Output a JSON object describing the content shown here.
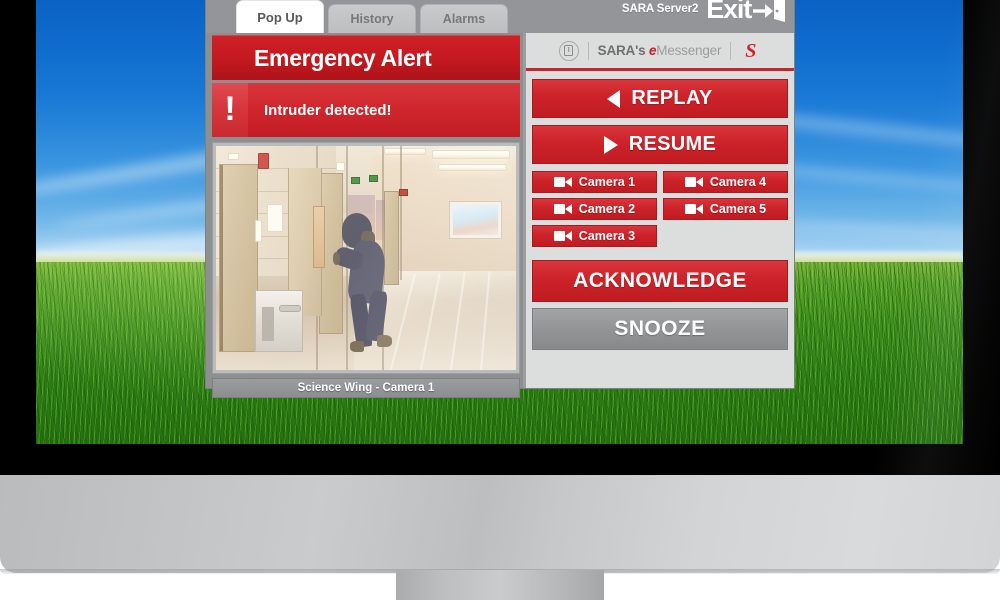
{
  "window": {
    "tabs": [
      {
        "label": "Pop Up",
        "active": true
      },
      {
        "label": "History",
        "active": false
      },
      {
        "label": "Alarms",
        "active": false
      }
    ],
    "server_label": "SARA Server2",
    "exit_label": "Exit",
    "exit_icon": "exit-door-arrow-icon"
  },
  "alert": {
    "title": "Emergency Alert",
    "bang": "!",
    "message": "Intruder detected!"
  },
  "video": {
    "caption": "Science Wing - Camera 1",
    "scene": "school-hallway-intruder"
  },
  "brand": {
    "badge_icon": "alert-bell-badge-icon",
    "sara": "SARA's ",
    "e": "e",
    "messenger": "Messenger",
    "logo_s": "S"
  },
  "controls": {
    "replay_label": "REPLAY",
    "replay_icon": "rewind-triangle-icon",
    "resume_label": "RESUME",
    "resume_icon": "play-triangle-icon",
    "cameras": [
      {
        "label": "Camera 1",
        "icon": "video-camera-icon"
      },
      {
        "label": "Camera 4",
        "icon": "video-camera-icon"
      },
      {
        "label": "Camera 2",
        "icon": "video-camera-icon"
      },
      {
        "label": "Camera 5",
        "icon": "video-camera-icon"
      },
      {
        "label": "Camera 3",
        "icon": "video-camera-icon"
      }
    ],
    "acknowledge_label": "ACKNOWLEDGE",
    "snooze_label": "SNOOZE"
  },
  "colors": {
    "alert_red": "#c8202a",
    "button_red": "#cd2229",
    "panel_gray": "#dcdddd",
    "window_gray": "#8d8f91",
    "snooze_gray": "#949698"
  }
}
